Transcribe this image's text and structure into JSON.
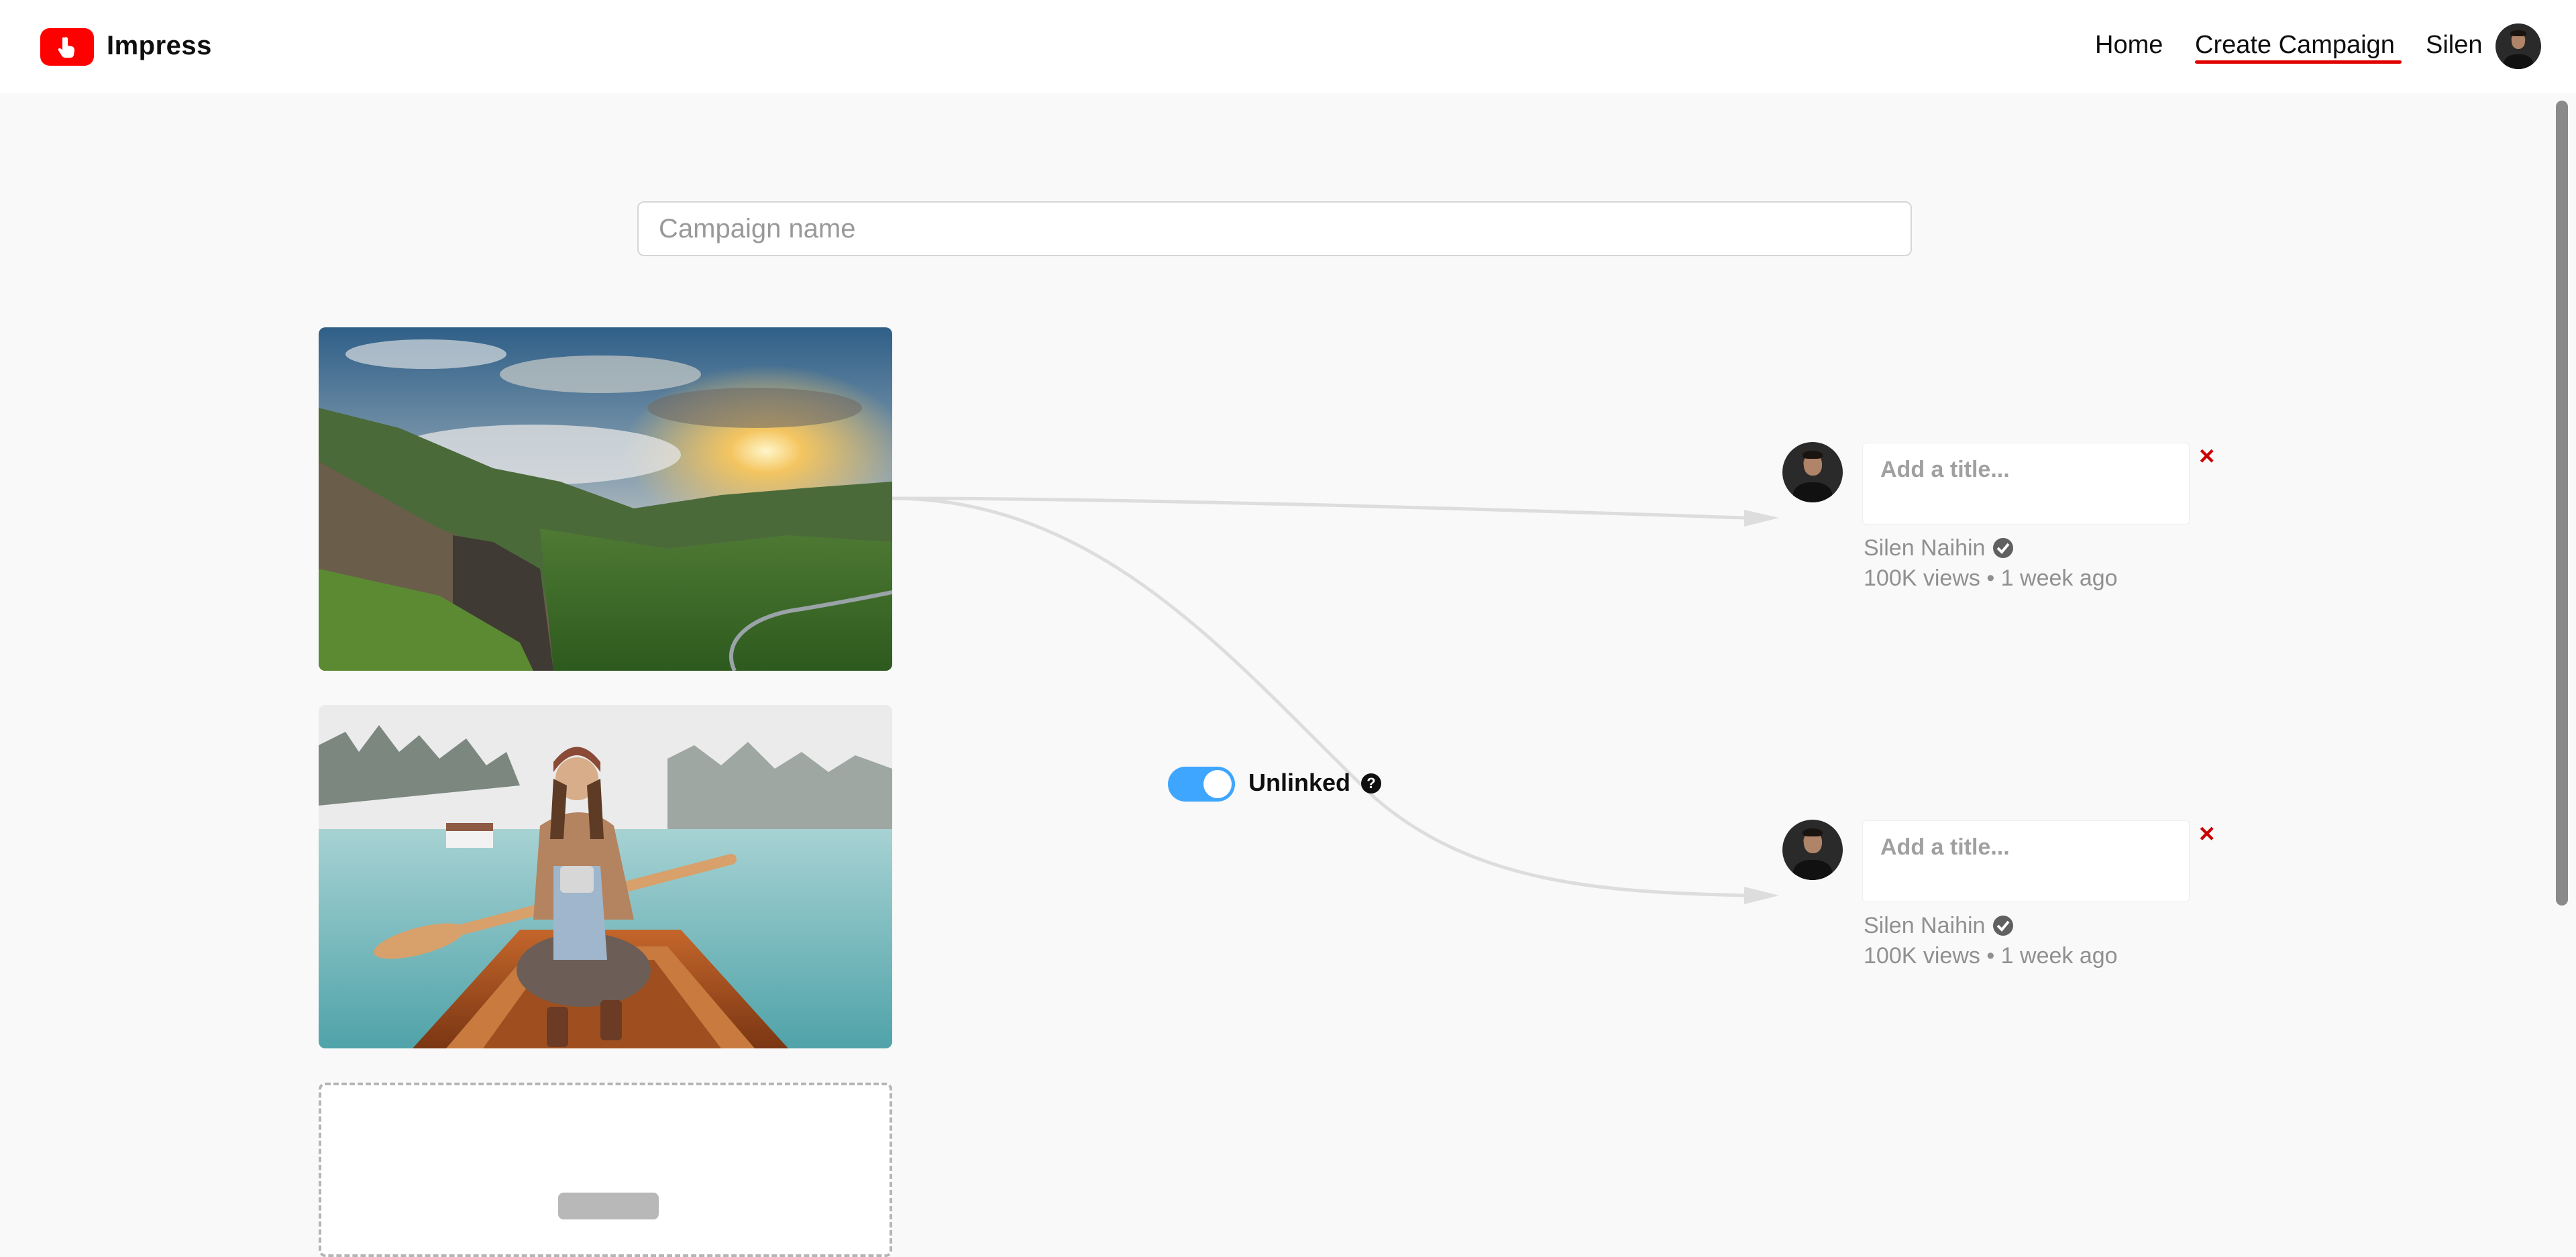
{
  "header": {
    "brand": "Impress",
    "nav": {
      "home": "Home",
      "create_campaign": "Create Campaign",
      "user_name": "Silen"
    },
    "active_nav": "create_campaign",
    "accent_color": "#ff0000"
  },
  "campaign": {
    "name_placeholder": "Campaign name",
    "name_value": ""
  },
  "link_toggle": {
    "label": "Unlinked",
    "on": true,
    "help_icon": "question-circle-icon"
  },
  "thumbnails": [
    {
      "alt": "Mountain valley at sunset"
    },
    {
      "alt": "Woman in a canoe on a lake"
    }
  ],
  "videos": [
    {
      "title_placeholder": "Add a title...",
      "channel": "Silen Naihin",
      "meta": "100K views • 1 week ago",
      "remove": "×"
    },
    {
      "title_placeholder": "Add a title...",
      "channel": "Silen Naihin",
      "meta": "100K views • 1 week ago",
      "remove": "×"
    }
  ]
}
